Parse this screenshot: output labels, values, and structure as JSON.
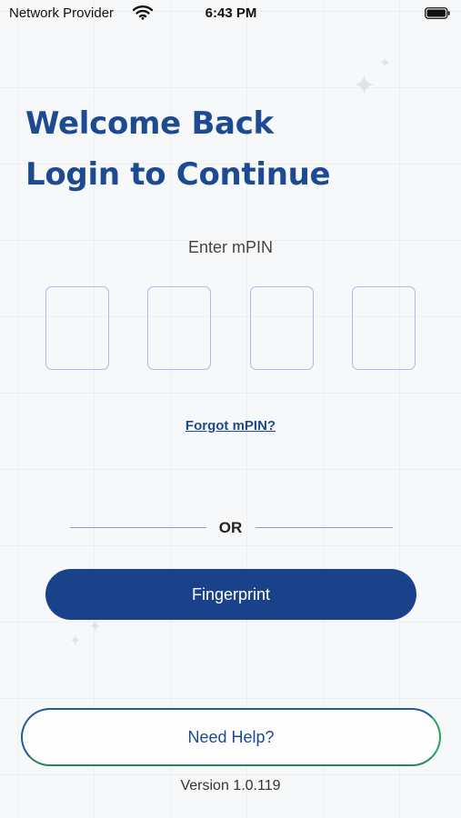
{
  "status_bar": {
    "carrier": "Network Provider",
    "time": "6:43 PM",
    "wifi_icon": "wifi-icon",
    "battery_icon": "battery-icon"
  },
  "header": {
    "line1": "Welcome Back",
    "line2": "Login to Continue"
  },
  "mpin": {
    "label": "Enter mPIN",
    "digits": [
      "",
      "",
      "",
      ""
    ],
    "forgot_label": "Forgot mPIN?"
  },
  "divider": {
    "label": "OR"
  },
  "fingerprint_button": {
    "label": "Fingerprint"
  },
  "help_button": {
    "label": "Need Help?"
  },
  "footer": {
    "version": "Version 1.0.119"
  },
  "colors": {
    "brand": "#1c4b91",
    "button_bg": "#1a428b",
    "pin_border": "#a9bfe3",
    "help_border_start": "#1d5aa0",
    "help_border_end": "#2aa05a"
  }
}
